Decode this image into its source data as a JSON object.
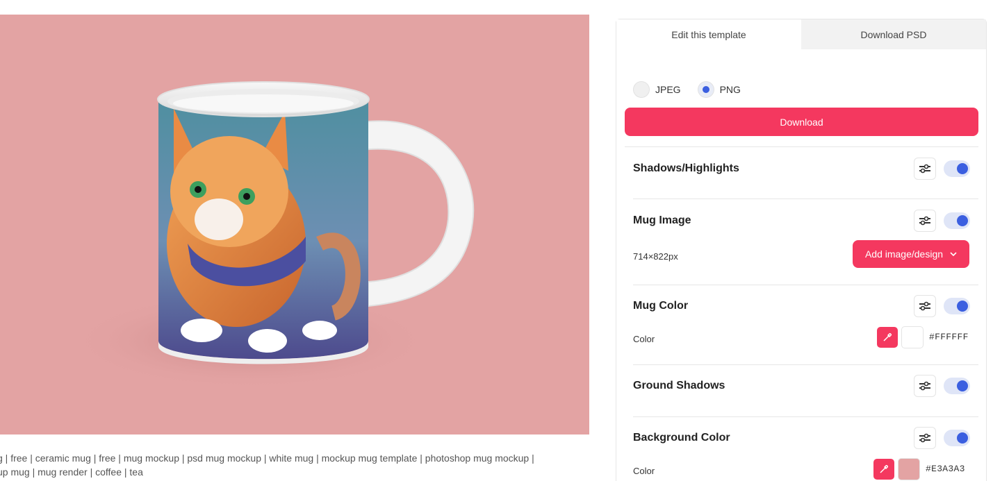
{
  "tabs": [
    {
      "label": "Edit this template",
      "active": true
    },
    {
      "label": "Download PSD",
      "active": false
    }
  ],
  "format": {
    "options": [
      "JPEG",
      "PNG"
    ],
    "selected": "PNG"
  },
  "download_label": "Download",
  "sections": {
    "shadows": {
      "title": "Shadows/Highlights",
      "enabled": true
    },
    "mug_image": {
      "title": "Mug Image",
      "size": "714×822px",
      "add_label": "Add image/design",
      "enabled": true
    },
    "mug_color": {
      "title": "Mug Color",
      "color_label": "Color",
      "hex": "#FFFFFF",
      "enabled": true
    },
    "ground_shadows": {
      "title": "Ground Shadows",
      "enabled": true
    },
    "background_color": {
      "title": "Background Color",
      "color_label": "Color",
      "hex": "#E3A3A3",
      "enabled": true
    }
  },
  "tags": {
    "line1": "g | free | ceramic mug | free | mug mockup | psd mug mockup | white mug | mockup mug template | photoshop mug mockup |",
    "line2": "up mug | mug render | coffee | tea"
  },
  "colors": {
    "accent": "#F4385F",
    "toggle": "#3B5FE0",
    "preview_background": "#E3A3A3"
  },
  "icons": [
    "sliders-icon",
    "eyedropper-icon",
    "chevron-down-icon"
  ]
}
